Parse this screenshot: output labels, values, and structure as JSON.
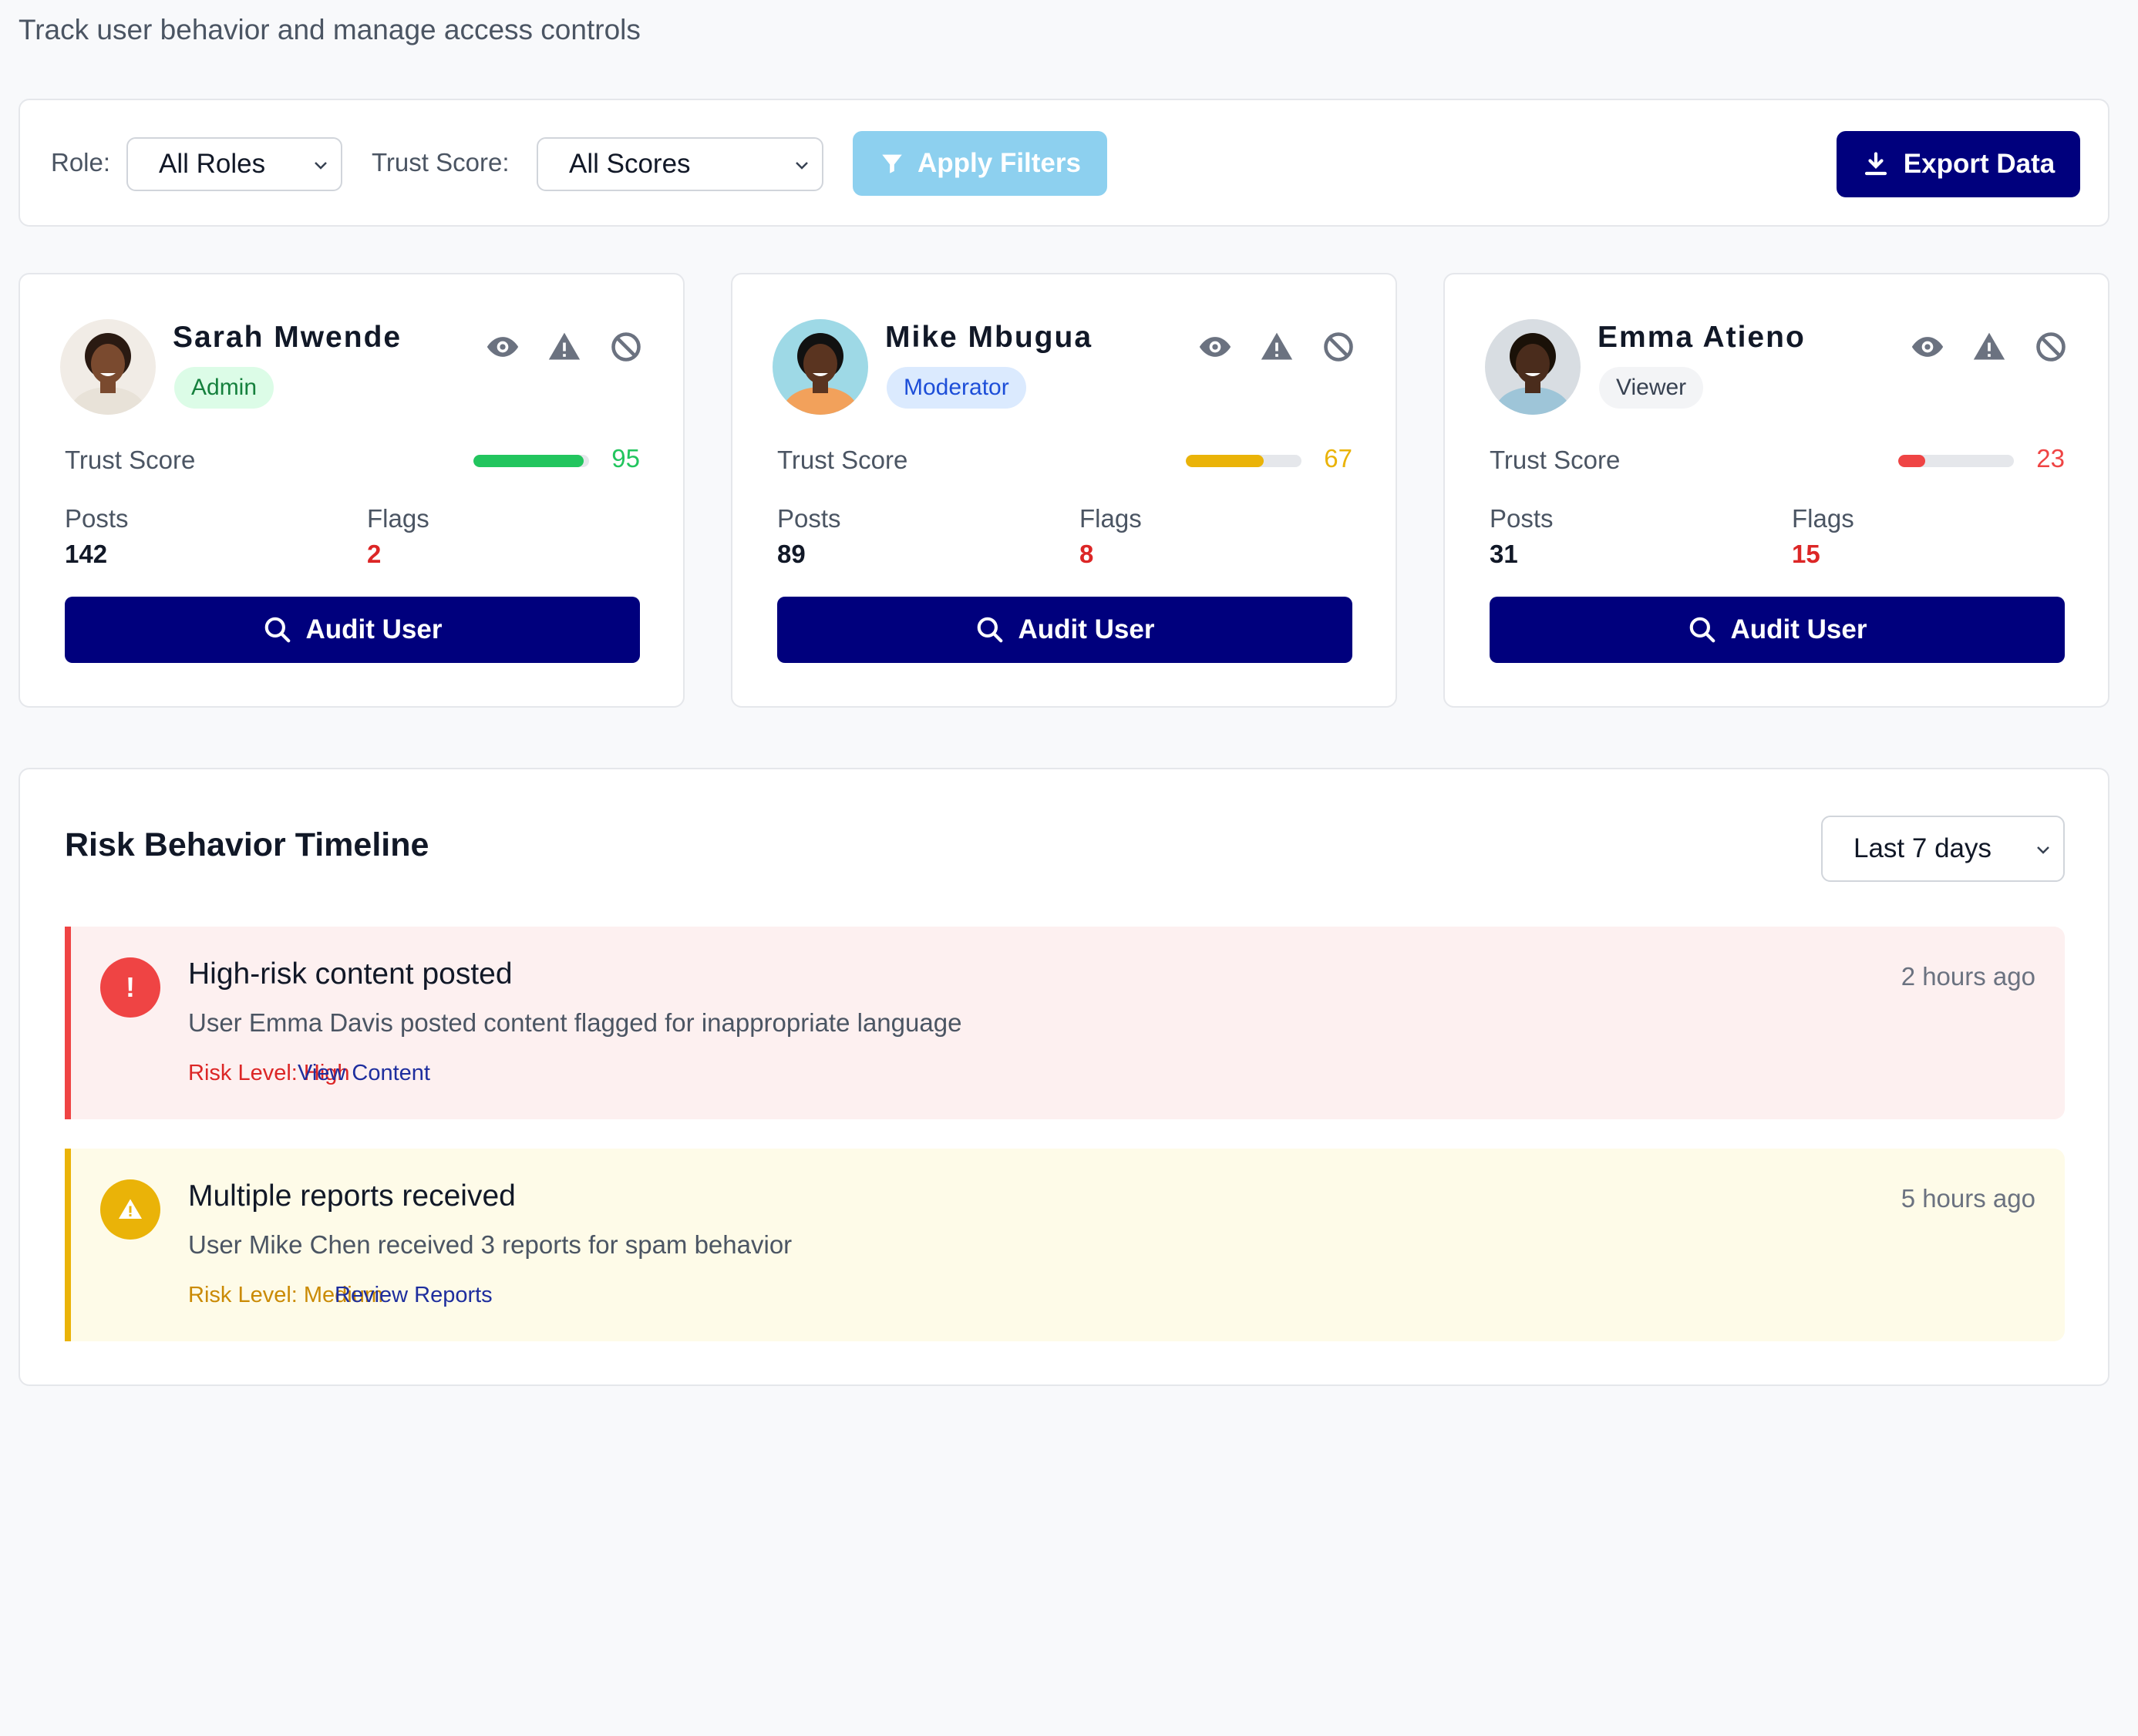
{
  "page": {
    "subtitle": "Track user behavior and manage access controls"
  },
  "filters": {
    "role_label": "Role:",
    "role_value": "All Roles",
    "trust_label": "Trust Score:",
    "trust_value": "All Scores",
    "apply_label": "Apply Filters",
    "export_label": "Export Data"
  },
  "users": [
    {
      "name": "Sarah Mwende",
      "role": "Admin",
      "trust_label": "Trust Score",
      "trust_score": "95",
      "trust_fraction": 0.95,
      "posts_label": "Posts",
      "posts": "142",
      "flags_label": "Flags",
      "flags": "2",
      "audit_label": "Audit User",
      "color": "#22c55e",
      "badge_bg": "#dcfce7",
      "badge_fg": "#15803d"
    },
    {
      "name": "Mike Mbugua",
      "role": "Moderator",
      "trust_label": "Trust Score",
      "trust_score": "67",
      "trust_fraction": 0.67,
      "posts_label": "Posts",
      "posts": "89",
      "flags_label": "Flags",
      "flags": "8",
      "audit_label": "Audit User",
      "color": "#eab308",
      "badge_bg": "#dbeafe",
      "badge_fg": "#1d4ed8"
    },
    {
      "name": "Emma Atieno",
      "role": "Viewer",
      "trust_label": "Trust Score",
      "trust_score": "23",
      "trust_fraction": 0.23,
      "posts_label": "Posts",
      "posts": "31",
      "flags_label": "Flags",
      "flags": "15",
      "audit_label": "Audit User",
      "color": "#ef4444",
      "badge_bg": "#f3f4f6",
      "badge_fg": "#374151"
    }
  ],
  "timeline": {
    "title": "Risk Behavior Timeline",
    "range": "Last 7 days",
    "events": [
      {
        "icon": "!",
        "title": "High-risk content posted",
        "time": "2 hours ago",
        "description": "User Emma Davis posted content flagged for inappropriate language",
        "risk": "Risk Level: High",
        "link": "View Content",
        "accent": "#ef4444",
        "bg": "#fdf0f0",
        "risk_color": "#dc2626"
      },
      {
        "icon": "warning",
        "title": "Multiple reports received",
        "time": "5 hours ago",
        "description": "User Mike Chen received 3 reports for spam behavior",
        "risk": "Risk Level: Medium",
        "link": "Review Reports",
        "accent": "#eab308",
        "bg": "#fefbe8",
        "risk_color": "#ca8a04"
      }
    ]
  },
  "colors": {
    "primary": "#00007d",
    "apply_disabled": "#8dd0ef",
    "flag_red": "#dc2626"
  }
}
